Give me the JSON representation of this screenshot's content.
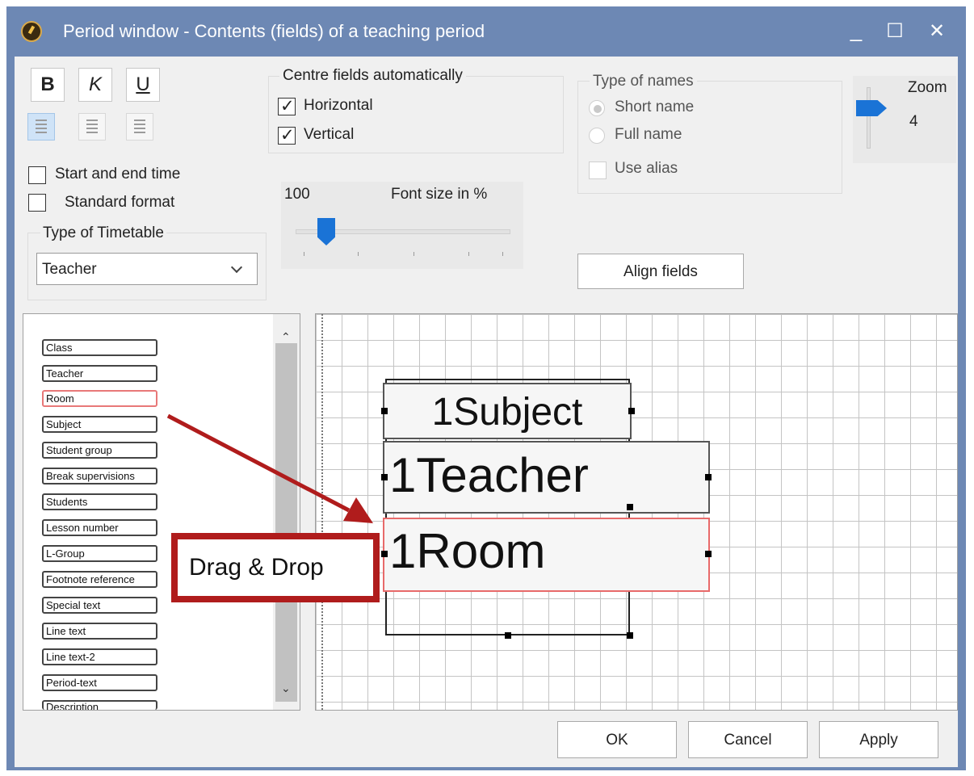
{
  "window": {
    "title": "Period window - Contents (fields) of a teaching period",
    "minimize": "_",
    "maximize": "☐",
    "close": "✕"
  },
  "formatting": {
    "bold": "B",
    "italic": "K",
    "underline": "U"
  },
  "centre_fields": {
    "title": "Centre fields automatically",
    "horizontal_label": "Horizontal",
    "horizontal_checked": true,
    "vertical_label": "Vertical",
    "vertical_checked": true
  },
  "type_of_names": {
    "title": "Type of names",
    "short_name": "Short name",
    "full_name": "Full name",
    "selected": "Short name",
    "use_alias": "Use alias"
  },
  "zoom": {
    "label": "Zoom",
    "value": "4"
  },
  "options": {
    "start_end_time": "Start and end time",
    "standard_format": "Standard format"
  },
  "timetable": {
    "group_label": "Type of Timetable",
    "selected": "Teacher"
  },
  "font_size": {
    "value": "100",
    "label": "Font size in %"
  },
  "align_fields_button": "Align fields",
  "field_list": [
    "Class",
    "Teacher",
    "Room",
    "Subject",
    "Student group",
    "Break supervisions",
    "Students",
    "Lesson number",
    "L-Group",
    "Footnote reference",
    "Special text",
    "Line text",
    "Line text-2",
    "Period-text",
    "Description"
  ],
  "highlighted_field": "Room",
  "canvas_fields": {
    "subject": "1Subject",
    "teacher": "1Teacher",
    "room": "1Room"
  },
  "annotation": {
    "label": "Drag & Drop",
    "color": "#b01c1c"
  },
  "footer": {
    "ok": "OK",
    "cancel": "Cancel",
    "apply": "Apply"
  }
}
